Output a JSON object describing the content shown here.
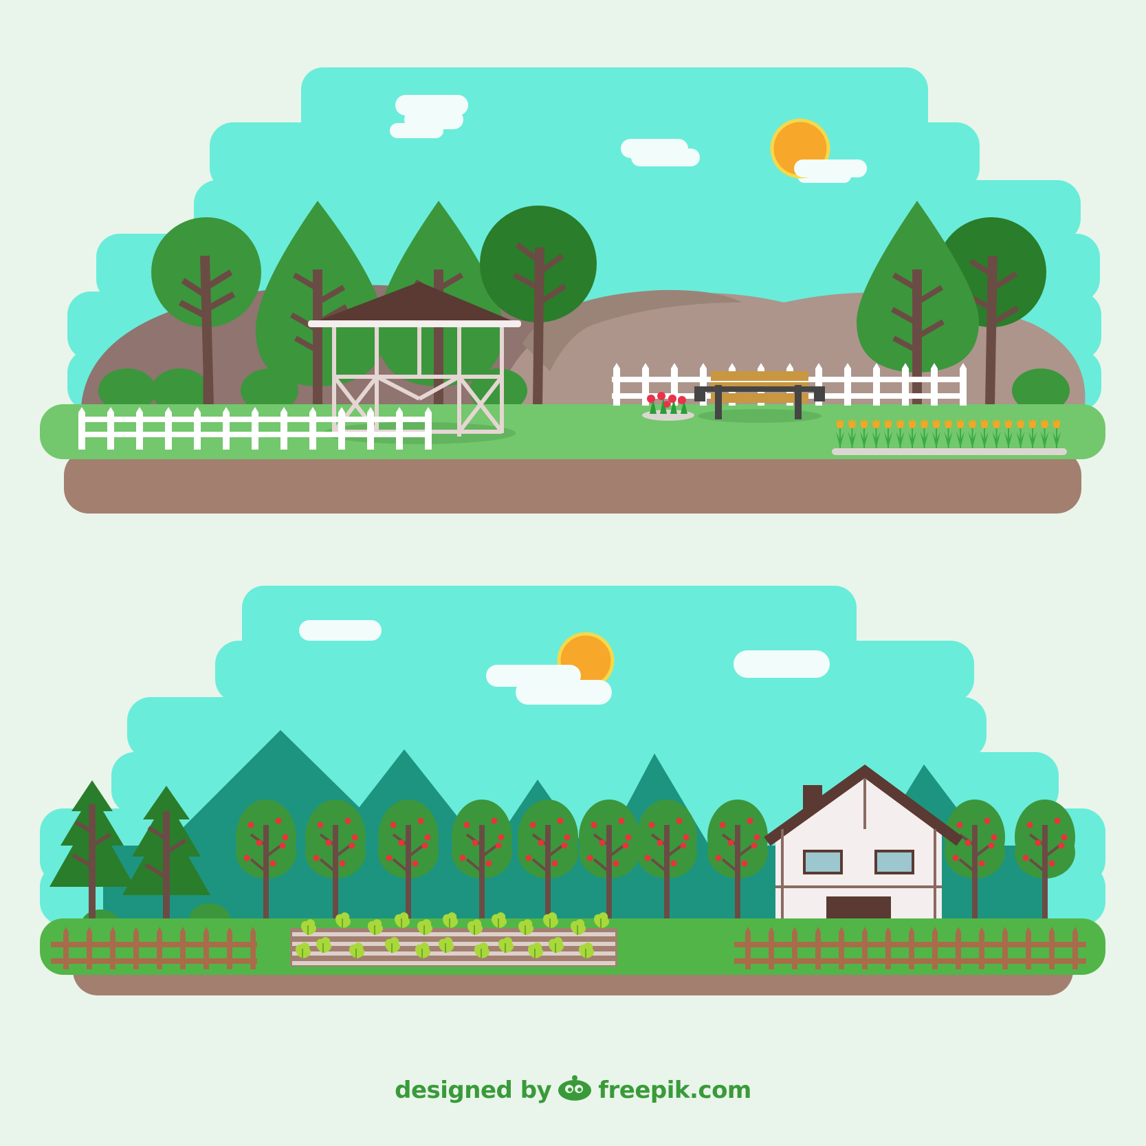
{
  "colors": {
    "background": "#e9f5ea",
    "sky": "#6aecda",
    "cloud": "#f2fcfa",
    "sun": "#f7a72a",
    "sun_ring": "#f5d94a",
    "hill_dark": "#8f7470",
    "hill_light": "#ad958c",
    "grass_top": "#73c76c",
    "grass_bottom": "#52b548",
    "soil": "#a37f70",
    "tree_light": "#3c963c",
    "tree_dark": "#2a7d2a",
    "trunk": "#6b4c44",
    "fence_white": "#ffffff",
    "fence_brown": "#a86c4a",
    "mountain": "#1d9480",
    "apple": "#e8333a",
    "house_wall": "#f4eeee",
    "house_roof": "#5a3a32",
    "bench": "#c9973f",
    "tulip": "#f5a623",
    "lettuce": "#a8d83a",
    "credit": "#3a9a3a"
  },
  "scenes": [
    {
      "name": "park",
      "items": [
        "gazebo",
        "bench",
        "white-fence",
        "tulip-bed",
        "flower-patch"
      ]
    },
    {
      "name": "farm",
      "items": [
        "house",
        "apple-orchard",
        "pine-trees",
        "vegetable-bed",
        "wooden-fence",
        "mountains"
      ]
    }
  ],
  "credit": {
    "prefix": "designed by",
    "brand": "freepik.com"
  }
}
